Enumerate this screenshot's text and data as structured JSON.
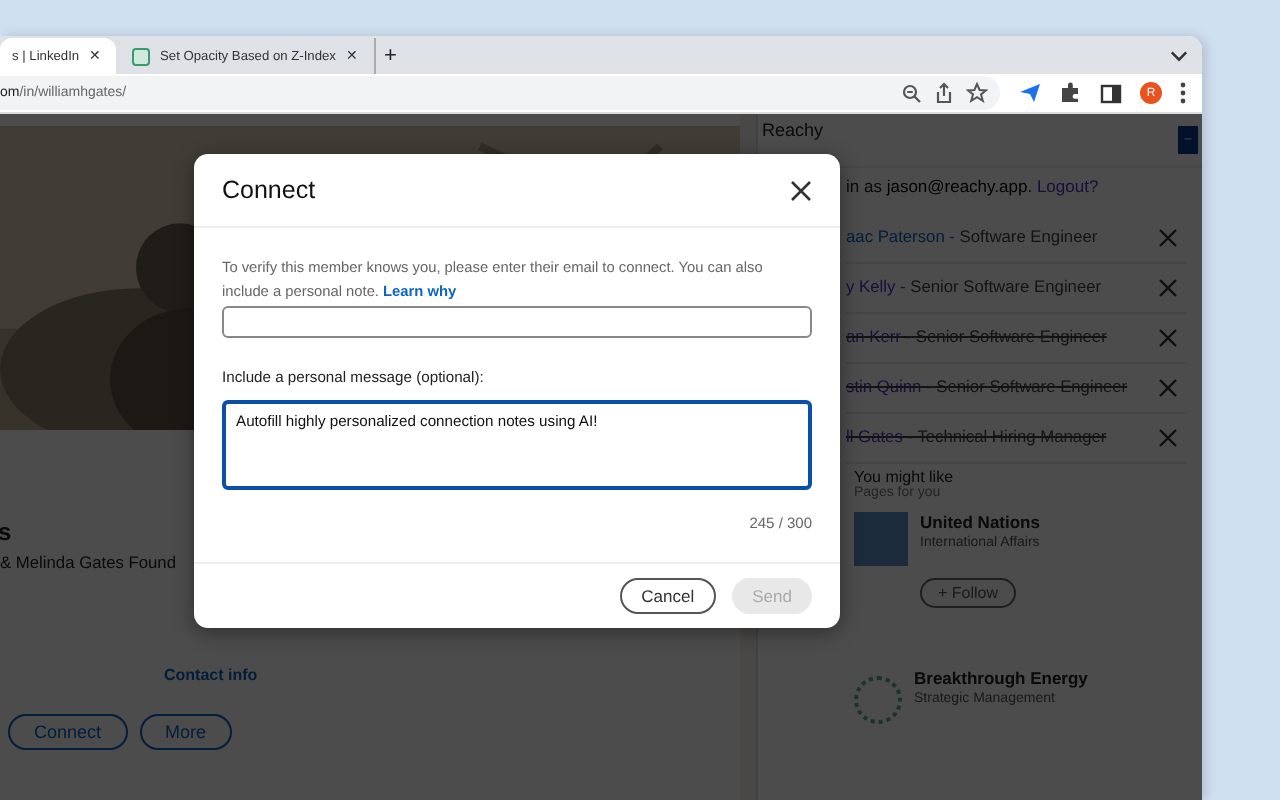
{
  "browser": {
    "tabs": [
      {
        "title": "s | LinkedIn",
        "close": "✕",
        "selected": true
      },
      {
        "title": "Set Opacity Based on Z-Index",
        "close": "✕",
        "selected": false
      }
    ],
    "new_tab": "+",
    "url_host": "om",
    "url_path": "/in/williamhgates/",
    "avatar": "R"
  },
  "profile": {
    "name": "s",
    "headline": "& Melinda Gates Found",
    "contact_link": "Contact info",
    "buttons": [
      "Connect",
      "More"
    ]
  },
  "reachy": {
    "title": "Reachy",
    "collapse": "–",
    "login_prefix": "in as",
    "email": "jason@reachy.app.",
    "logout": "Logout?",
    "separator": "-",
    "leads": [
      {
        "name": "aac Paterson",
        "role": "Software Engineer",
        "visited": false,
        "struck": false
      },
      {
        "name": "y Kelly",
        "role": "Senior Software Engineer",
        "visited": true,
        "struck": false
      },
      {
        "name": "an Kerr",
        "role": "Senior Software Engineer",
        "visited": true,
        "struck": true
      },
      {
        "name": "stin Quinn",
        "role": "Senior Software Engineer",
        "visited": true,
        "struck": true
      },
      {
        "name": "ll Gates",
        "role": "Technical Hiring Manager",
        "visited": true,
        "struck": true
      }
    ]
  },
  "suggestions": {
    "title": "You might like",
    "subtitle": "Pages for you",
    "pages": [
      {
        "name": "United Nations",
        "category": "International Affairs",
        "follow": "+ Follow"
      },
      {
        "name": "Breakthrough Energy",
        "category": "Strategic Management"
      }
    ]
  },
  "dialog": {
    "title": "Connect",
    "intro": "To verify this member knows you, please enter their email to connect. You can also include a personal note.",
    "learn_link": "Learn why",
    "message_label": "Include a personal message (optional):",
    "message": "Autofill highly personalized connection notes using AI!",
    "counter": "245 / 300",
    "buttons": [
      {
        "label": "Cancel",
        "kind": "secondary",
        "disabled": false
      },
      {
        "label": "Send",
        "kind": "primary",
        "disabled": true
      }
    ]
  }
}
